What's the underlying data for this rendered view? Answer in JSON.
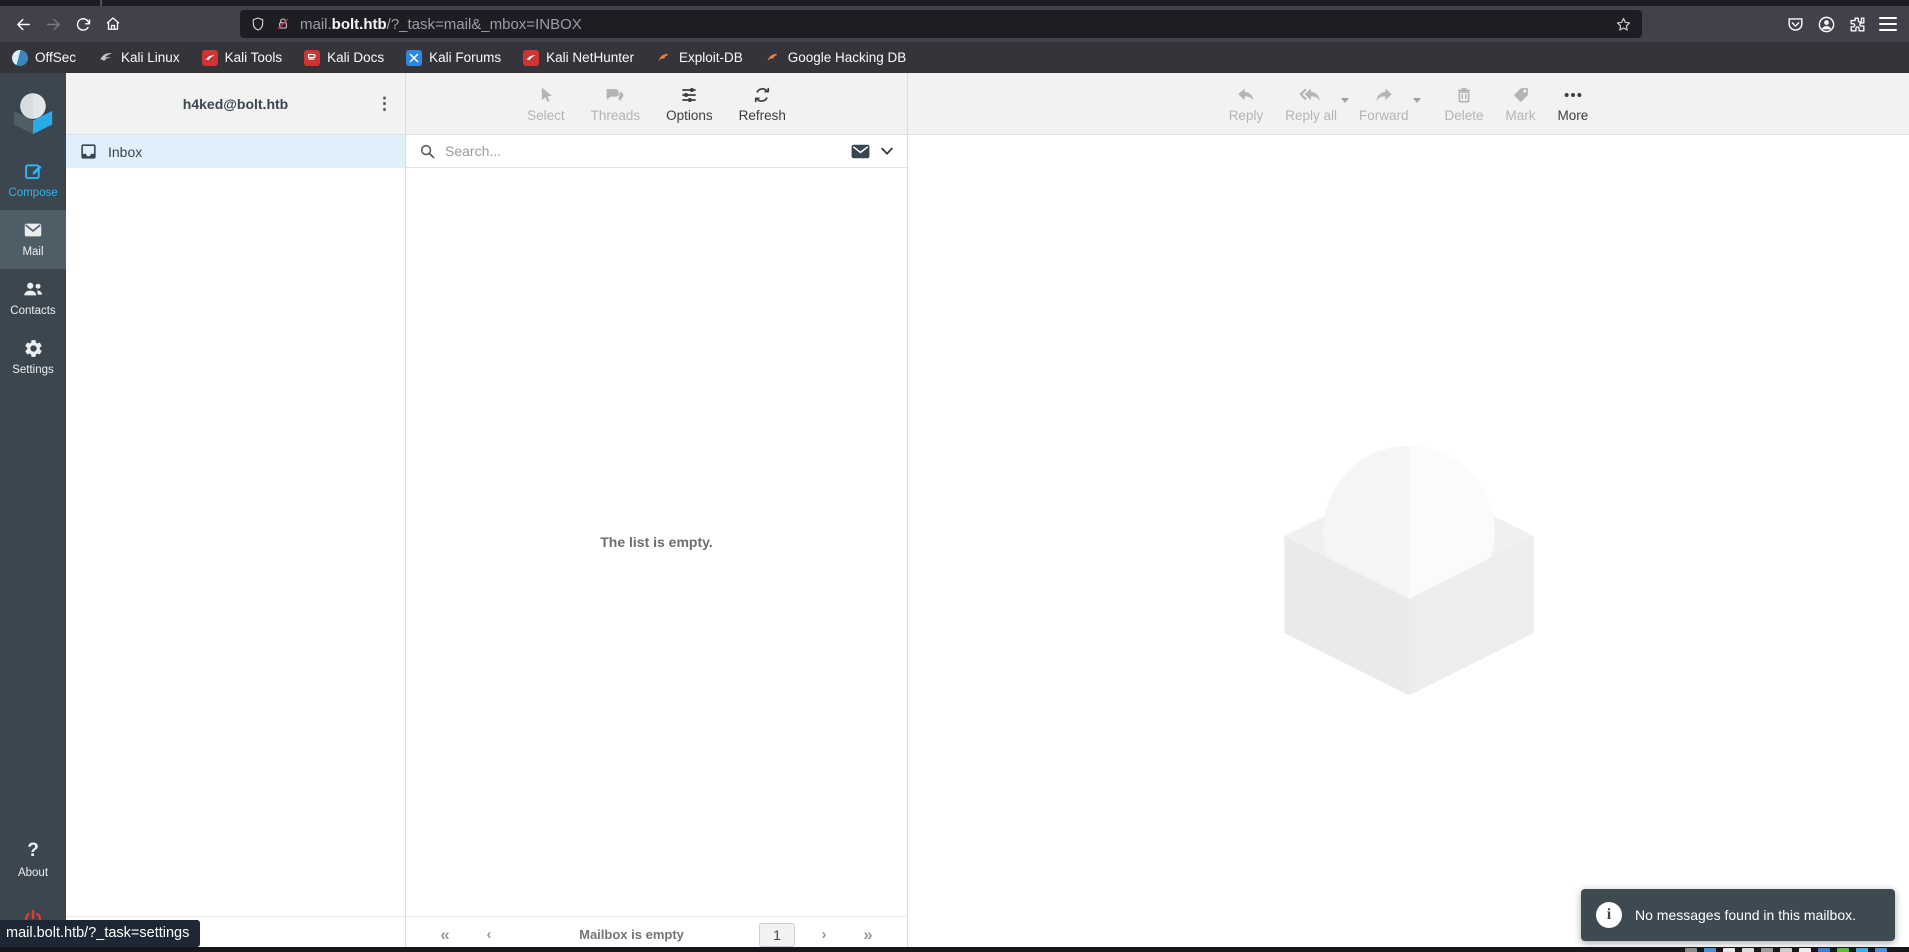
{
  "browser": {
    "url": {
      "prefix": "mail.",
      "domain": "bolt.htb",
      "path": "/?_task=mail&_mbox=INBOX"
    },
    "bookmarks": [
      {
        "label": "OffSec"
      },
      {
        "label": "Kali Linux"
      },
      {
        "label": "Kali Tools"
      },
      {
        "label": "Kali Docs"
      },
      {
        "label": "Kali Forums"
      },
      {
        "label": "Kali NetHunter"
      },
      {
        "label": "Exploit-DB"
      },
      {
        "label": "Google Hacking DB"
      }
    ]
  },
  "sidebar": {
    "compose": "Compose",
    "mail": "Mail",
    "contacts": "Contacts",
    "settings": "Settings",
    "about": "About"
  },
  "folders": {
    "account": "h4ked@bolt.htb",
    "inbox": "Inbox"
  },
  "list": {
    "toolbar": {
      "select": "Select",
      "threads": "Threads",
      "options": "Options",
      "refresh": "Refresh"
    },
    "search_placeholder": "Search...",
    "empty_message": "The list is empty.",
    "footer_status": "Mailbox is empty",
    "page": "1"
  },
  "content": {
    "toolbar": {
      "reply": "Reply",
      "reply_all": "Reply all",
      "forward": "Forward",
      "delete": "Delete",
      "mark": "Mark",
      "more": "More"
    }
  },
  "toast": {
    "message": "No messages found in this mailbox."
  },
  "statusbar": {
    "text": "mail.bolt.htb/?_task=settings"
  },
  "glyphs": {
    "kebab": "⋮",
    "first_page": "«",
    "prev_page": "‹",
    "next_page": "›",
    "last_page": "»",
    "about": "?",
    "info": "i"
  },
  "colors": {
    "accent_blue": "#2fb6f2",
    "sidebar_bg": "#3b464e",
    "sidebar_selected": "#4e5d66",
    "toolbar_bg": "#f2f2f2",
    "selected_folder_bg": "#dff0fb",
    "toast_bg": "#3e4a52",
    "logout_red": "#e53935",
    "browser_chrome": "#42414a",
    "urlbar_bg": "#1e1d24",
    "bookmarks_bar_bg": "#35343b",
    "insecure_strike": "#e2294a"
  },
  "taskbar_sliver_colors": [
    "#8a8a8a",
    "#4a90d9",
    "#e8e8e8",
    "#dddddd",
    "#9a9a9a",
    "#cccccc",
    "#ededed",
    "#3b7dd8",
    "#5fb93c",
    "#38b0de",
    "#4a90d9"
  ]
}
